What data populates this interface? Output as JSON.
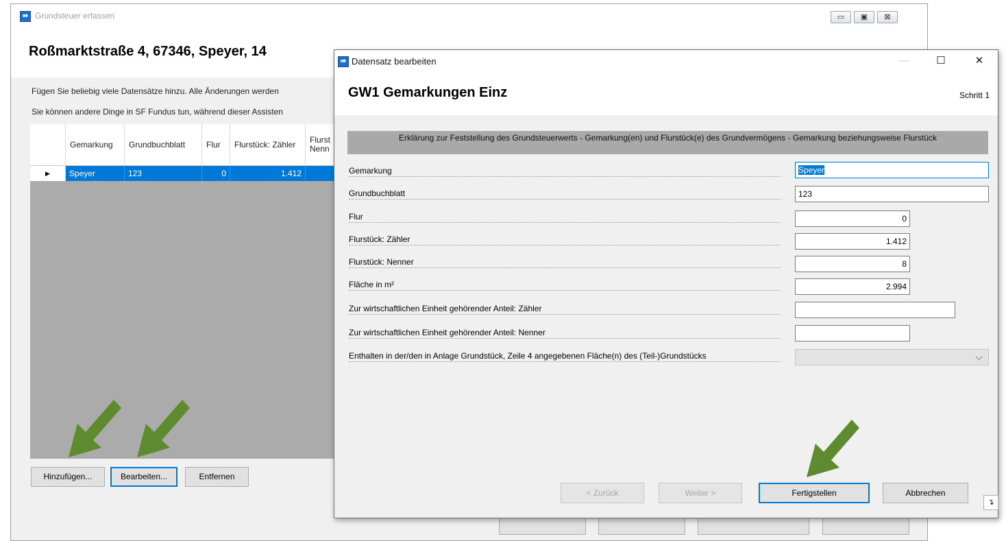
{
  "background_window": {
    "title": "Grundsteuer erfassen",
    "controls": {
      "minimize": "▭",
      "maximize": "▣",
      "close": "⊠"
    },
    "heading": "Roßmarktstraße 4, 67346, Speyer, 14",
    "info_line1": "Fügen Sie beliebig viele Datensätze hinzu. Alle Änderungen werden",
    "info_line2": "Sie können andere Dinge in SF Fundus tun, während dieser Assisten",
    "table": {
      "columns": [
        "Gemarkung",
        "Grundbuchblatt",
        "Flur",
        "Flurstück: Zähler",
        "Flurst Nenn"
      ],
      "row_marker": "▶",
      "rows": [
        {
          "gemarkung": "Speyer",
          "grundbuchblatt": "123",
          "flur": "0",
          "zaehler": "1.412",
          "nenner": ""
        }
      ]
    },
    "buttons": {
      "add": "Hinzufügen...",
      "edit": "Bearbeiten...",
      "remove": "Entfernen"
    }
  },
  "dialog": {
    "title": "Datensatz bearbeiten",
    "controls": {
      "minimize": "—",
      "maximize": "☐",
      "close": "✕"
    },
    "heading": "GW1 Gemarkungen Einz",
    "step": "Schritt 1",
    "section_title": "Erklärung zur Feststellung des Grundsteuerwerts - Gemarkung(en) und Flurstück(e) des Grundvermögens - Gemarkung beziehungsweise Flurstück",
    "fields": {
      "gemarkung": {
        "label": "Gemarkung",
        "value": "Speyer"
      },
      "grundbuchblatt": {
        "label": "Grundbuchblatt",
        "value": "123"
      },
      "flur": {
        "label": "Flur",
        "value": "0"
      },
      "zaehler": {
        "label": "Flurstück: Zähler",
        "value": "1.412"
      },
      "nenner": {
        "label": "Flurstück: Nenner",
        "value": "8"
      },
      "flaeche": {
        "label": "Fläche in m²",
        "value": "2.994"
      },
      "anteil_zaehler": {
        "label": "Zur wirtschaftlichen Einheit gehörender Anteil: Zähler",
        "value": ""
      },
      "anteil_nenner": {
        "label": "Zur wirtschaftlichen Einheit gehörender Anteil: Nenner",
        "value": ""
      },
      "enthalten": {
        "label": "Enthalten in der/den in Anlage Grundstück, Zeile 4 angegebenen Fläche(n) des (Teil-)Grundstücks",
        "value": ""
      }
    },
    "buttons": {
      "back": "< Zurück",
      "next": "Weiter >",
      "finish": "Fertigstellen",
      "cancel": "Abbrechen"
    },
    "grip_glyph": "↴"
  },
  "colors": {
    "selection": "#0078d7",
    "arrow": "#5e8b2f",
    "section_bar": "#a9a9a9"
  }
}
